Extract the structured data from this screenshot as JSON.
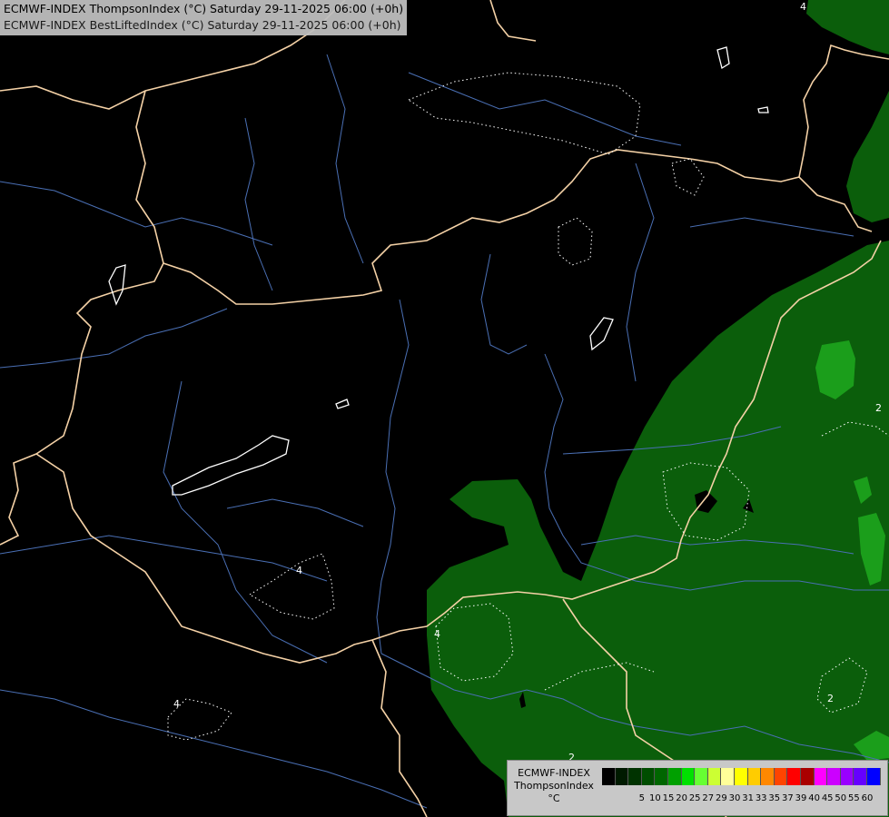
{
  "header": {
    "line1": "ECMWF-INDEX ThompsonIndex (°C) Saturday 29-11-2025 06:00 (+0h)",
    "line2": "ECMWF-INDEX BestLiftedIndex (°C) Saturday 29-11-2025 06:00 (+0h)"
  },
  "legend": {
    "title_lines": [
      "ECMWF-INDEX",
      "ThompsonIndex",
      "°C"
    ],
    "colors": [
      "#000000",
      "#001a00",
      "#003300",
      "#004d00",
      "#006600",
      "#00a000",
      "#00e000",
      "#66ff33",
      "#ccff33",
      "#ffff99",
      "#ffff00",
      "#ffcc00",
      "#ff8800",
      "#ff4400",
      "#ff0000",
      "#aa0000",
      "#ff00ff",
      "#cc00ff",
      "#9900ff",
      "#6600ff",
      "#0000ff"
    ],
    "ticks": [
      "5",
      "10",
      "15",
      "20",
      "25",
      "27",
      "29",
      "30",
      "31",
      "33",
      "35",
      "37",
      "39",
      "40",
      "45",
      "50",
      "55",
      "60"
    ]
  },
  "contour_labels": [
    "4",
    "4",
    "4",
    "4",
    "2",
    "2",
    "2"
  ],
  "colors": {
    "ocean_bg": "#000000",
    "field_green": "#0b5e0b",
    "field_bright": "#1b9e1b",
    "border": "#f4d1a6",
    "river": "#4a6fb4",
    "lake": "#ffffff"
  }
}
